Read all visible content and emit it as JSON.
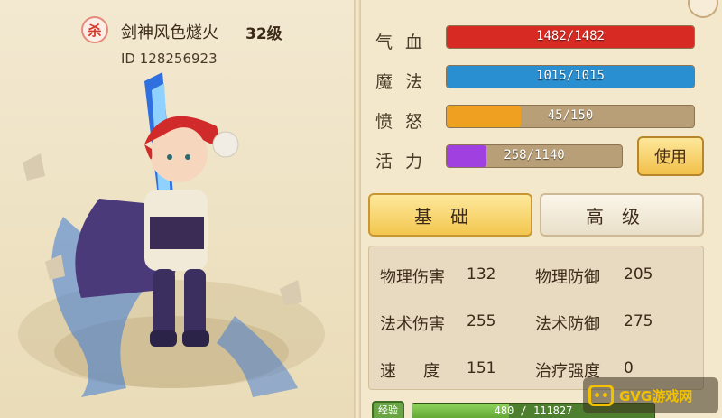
{
  "character": {
    "badge_text": "杀",
    "name": "剑神风色燧火",
    "level": "32级",
    "id": "ID 128256923"
  },
  "stats": [
    {
      "label": "气血",
      "value": "1482/1482",
      "fill": 1.0,
      "color": "#d62a22"
    },
    {
      "label": "魔法",
      "value": "1015/1015",
      "fill": 1.0,
      "color": "#2a8fd0"
    },
    {
      "label": "愤怒",
      "value": "45/150",
      "fill": 0.3,
      "color": "#f0a020"
    },
    {
      "label": "活力",
      "value": "258/1140",
      "fill": 0.226,
      "color": "#a040e0"
    }
  ],
  "use_button": "使用",
  "tabs": {
    "basic": "基础",
    "advanced": "高级"
  },
  "attributes": [
    {
      "name": "物理伤害",
      "value": "132"
    },
    {
      "name": "物理防御",
      "value": "205"
    },
    {
      "name": "法术伤害",
      "value": "255"
    },
    {
      "name": "法术防御",
      "value": "275"
    },
    {
      "name": "速度",
      "value": "151"
    },
    {
      "name": "治疗强度",
      "value": "0"
    }
  ],
  "exp": {
    "icon_text": "经验",
    "value": "480 / 111827",
    "fill": 0.004
  },
  "watermark": "GVG游戏网"
}
